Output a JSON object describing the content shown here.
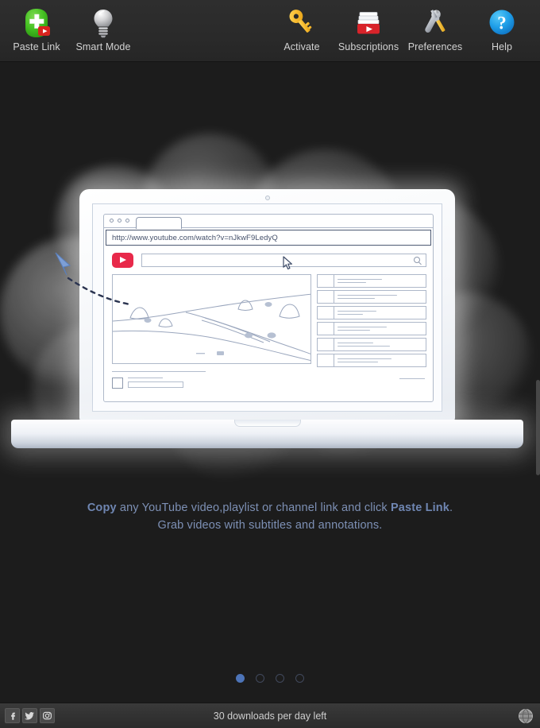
{
  "toolbar": {
    "left_items": [
      {
        "label": "Paste Link",
        "icon": "paste-link-icon"
      },
      {
        "label": "Smart Mode",
        "icon": "lightbulb-icon"
      }
    ],
    "right_items": [
      {
        "label": "Activate",
        "icon": "key-icon"
      },
      {
        "label": "Subscriptions",
        "icon": "subscriptions-tray-icon"
      },
      {
        "label": "Preferences",
        "icon": "tools-icon"
      },
      {
        "label": "Help",
        "icon": "help-question-icon"
      }
    ]
  },
  "hero": {
    "browser_mock": {
      "url": "http://www.youtube.com/watch?v=nJkwF9LedyQ",
      "search_placeholder": "",
      "sidebar_item_count": 6
    },
    "caption": {
      "line1_part1": "Copy",
      "line1_part2": " any YouTube video,playlist or channel link and click ",
      "line1_part3": "Paste Link",
      "line1_part4": ".",
      "line2": "Grab videos with subtitles and annotations."
    }
  },
  "pagination": {
    "total": 4,
    "active_index": 0
  },
  "statusbar": {
    "social": [
      {
        "name": "facebook-icon",
        "glyph": "f"
      },
      {
        "name": "twitter-icon",
        "glyph": "ᴠ"
      },
      {
        "name": "instagram-icon",
        "glyph": "◎"
      }
    ],
    "downloads_text": "30 downloads per day left",
    "globe_icon": "globe-icon"
  },
  "colors": {
    "accent_blue": "#4d74b8",
    "caption_blue": "#7d90b5",
    "youtube_red": "#e8294a",
    "toolbar_bg": "#2b2b2b",
    "window_bg": "#1c1c1c"
  }
}
